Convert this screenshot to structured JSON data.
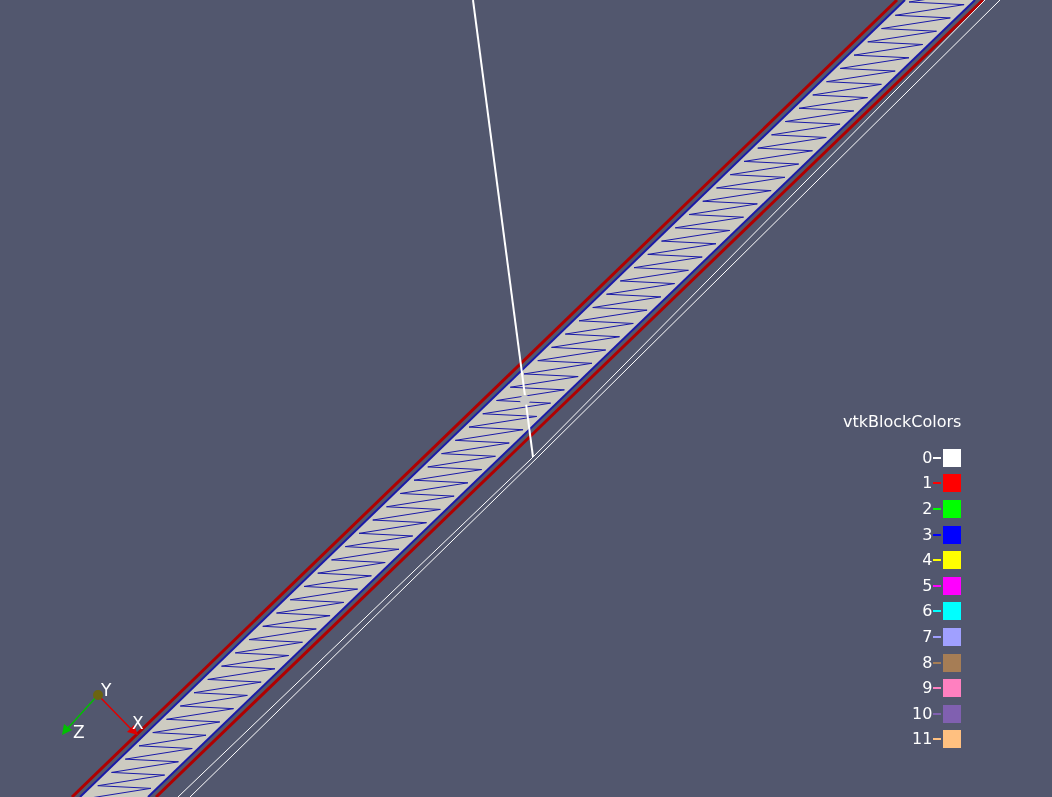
{
  "legend": {
    "title": "vtkBlockColors",
    "entries": [
      {
        "label": "0",
        "color": "#ffffff"
      },
      {
        "label": "1",
        "color": "#ff0000"
      },
      {
        "label": "2",
        "color": "#00ff00"
      },
      {
        "label": "3",
        "color": "#0000ff"
      },
      {
        "label": "4",
        "color": "#ffff00"
      },
      {
        "label": "5",
        "color": "#ff00ff"
      },
      {
        "label": "6",
        "color": "#00ffff"
      },
      {
        "label": "7",
        "color": "#a0a0ff"
      },
      {
        "label": "8",
        "color": "#a67d55"
      },
      {
        "label": "9",
        "color": "#ff80c0"
      },
      {
        "label": "10",
        "color": "#8060b0"
      },
      {
        "label": "11",
        "color": "#ffc080"
      }
    ]
  },
  "orientation_axes": {
    "labels": [
      {
        "kind": "y",
        "text": "Y"
      },
      {
        "kind": "z",
        "text": "Z"
      },
      {
        "kind": "x",
        "text": "X"
      }
    ]
  }
}
